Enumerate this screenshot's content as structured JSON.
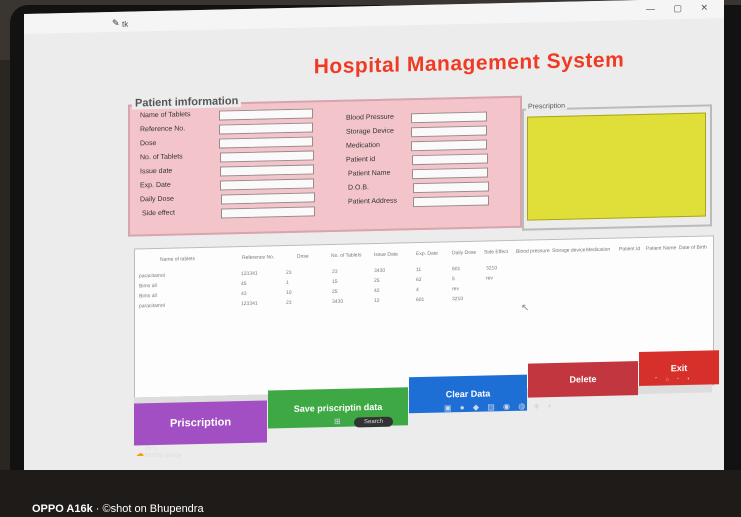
{
  "window": {
    "title": "tk",
    "controls": "— ▢ ✕"
  },
  "app": {
    "title": "Hospital Management System"
  },
  "patient": {
    "legend": "Patient imformation",
    "left_labels": [
      "Name of Tablets",
      "Reference No.",
      "Dose",
      "No. of Tablets",
      "Issue date",
      "Exp. Date",
      "Daily Dose",
      "Side effect"
    ],
    "right_labels": [
      "Blood Pressure",
      "Storage Device",
      "Medication",
      "Patient id",
      "Patient Name",
      "D.O.B.",
      "Patient Address"
    ]
  },
  "prescription": {
    "legend": "Prescription"
  },
  "table": {
    "headers": [
      "Name of tablets",
      "Reference No.",
      "Dose",
      "No. of Tablets",
      "Issue Date",
      "Exp. Date",
      "Daily Dose",
      "Side Effect",
      "Blood pressure",
      "Storage device",
      "Medication",
      "Patient Id",
      "Patient Name",
      "Date of Birth"
    ],
    "rows": [
      [
        "paracitamol",
        "123341",
        "23",
        "23",
        "3430",
        "11",
        "601",
        "3210"
      ],
      [
        "Bimo all",
        "45",
        "1",
        "15",
        "25",
        "62",
        "5",
        "rev"
      ],
      [
        "Bimo all",
        "43",
        "10",
        "25",
        "42",
        "4",
        "rev",
        ""
      ],
      [
        "paracitamol",
        "123341",
        "23",
        "3430",
        "12",
        "601",
        "3210",
        ""
      ]
    ]
  },
  "buttons": {
    "prescription": "Priscription",
    "save": "Save priscriptin data",
    "clear": "Clear Data",
    "delete": "Delete",
    "exit": "Exit"
  },
  "colors": {
    "prescription": "#a14fc2",
    "save": "#3ea944",
    "clear": "#1d6fd6",
    "delete": "#c2363f",
    "exit": "#d7302b"
  },
  "taskbar": {
    "search_placeholder": "Search"
  },
  "weather": {
    "temp": "26°C",
    "desc": "Mostly cloudy"
  },
  "watermark": {
    "device": "OPPO A16k",
    "separator": " · ",
    "shot": "©shot on Bhupendra"
  }
}
